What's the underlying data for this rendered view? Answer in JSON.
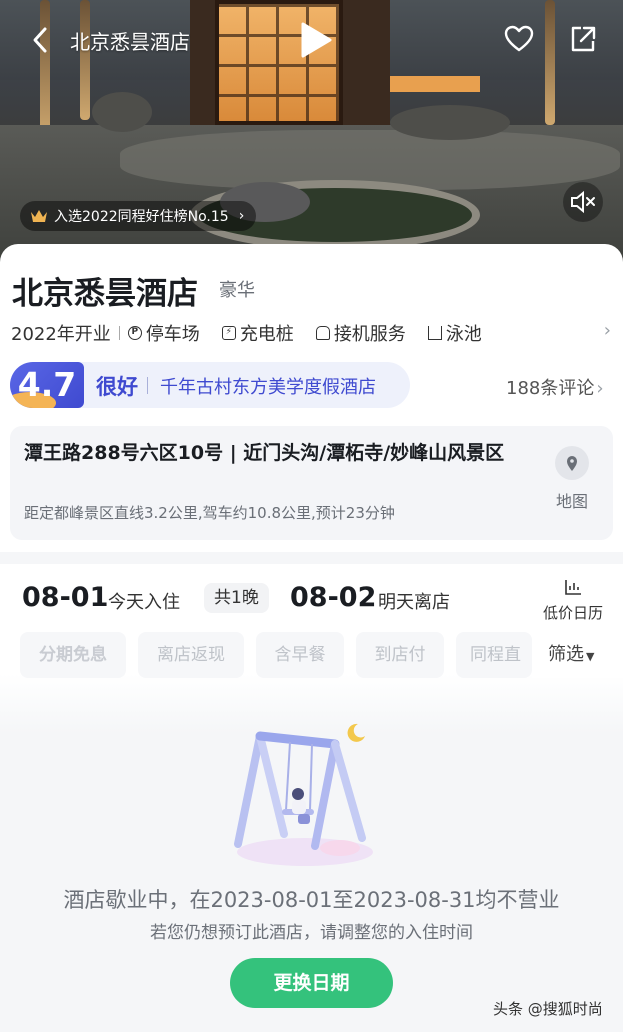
{
  "hero": {
    "title": "北京悉昙酒店",
    "rank_badge": "入选2022同程好住榜No.15",
    "rank_arrow": "›"
  },
  "hotel": {
    "name": "北京悉昙酒店",
    "level": "豪华",
    "amenities": [
      {
        "label": "2022年开业",
        "icon": "none"
      },
      {
        "label": "停车场",
        "icon": "parking-icon"
      },
      {
        "label": "充电桩",
        "icon": "charging-icon"
      },
      {
        "label": "接机服务",
        "icon": "car-icon"
      },
      {
        "label": "泳池",
        "icon": "pool-icon"
      }
    ],
    "more_arrow": "›",
    "rating": "4.7",
    "rating_word": "很好",
    "tagline": "千年古村东方美学度假酒店",
    "reviews": "188条评论",
    "reviews_arrow": "›",
    "address": "潭王路288号六区10号 | 近门头沟/潭柘寺/妙峰山风景区",
    "distance": "距定都峰景区直线3.2公里,驾车约10.8公里,预计23分钟",
    "map_label": "地图"
  },
  "booking": {
    "checkin_date": "08-01",
    "checkin_label": "今天入住",
    "nights": "共1晚",
    "checkout_date": "08-02",
    "checkout_label": "明天离店",
    "calendar_label": "低价日历",
    "filters": [
      "分期免息",
      "离店返现",
      "含早餐",
      "到店付",
      "同程直"
    ],
    "filter_button": "筛选",
    "closed_message": "酒店歇业中，在2023-08-01至2023-08-31均不营业",
    "closed_hint": "若您仍想预订此酒店，请调整您的入住时间",
    "change_date_button": "更换日期"
  },
  "watermark": "头条 @搜狐时尚",
  "colors": {
    "accent_green": "#34c27c",
    "rating_blue": "#3f4ad0",
    "rating_badge_bg": "#eef1fb"
  }
}
